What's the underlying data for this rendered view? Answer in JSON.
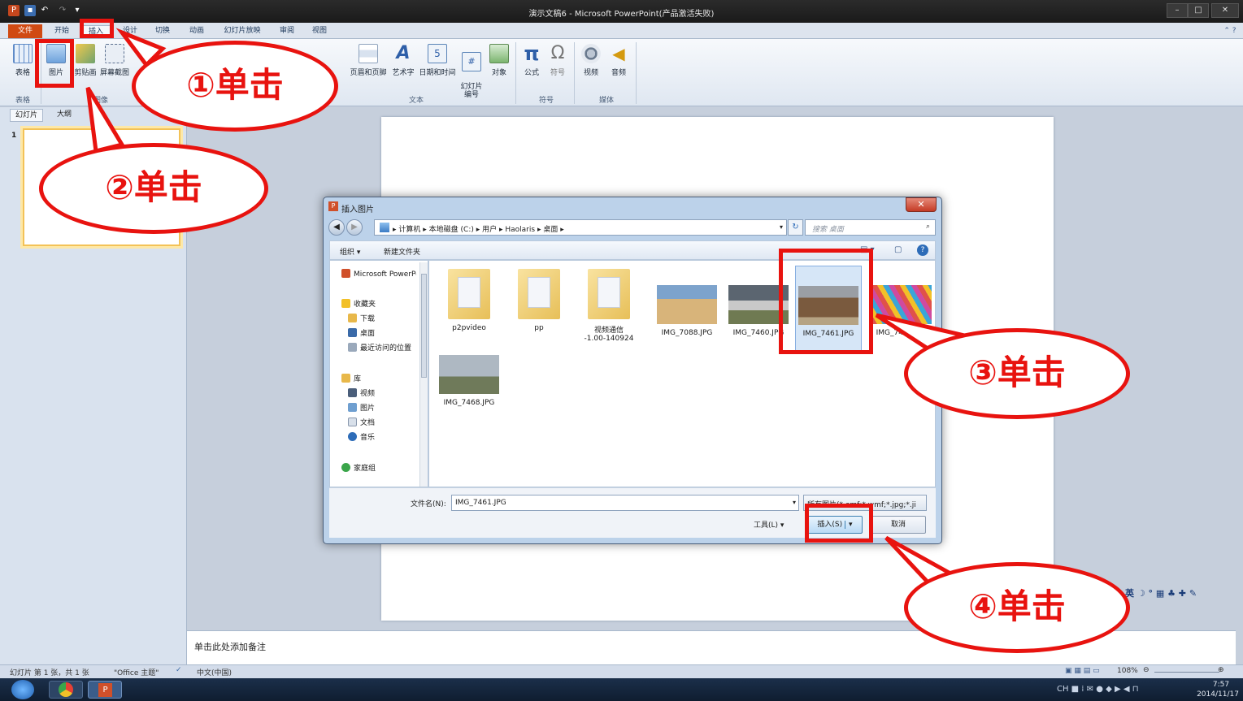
{
  "window": {
    "title": "演示文稿6 - Microsoft PowerPoint(产品激活失败)",
    "app_icon": "P"
  },
  "menu": {
    "tabs": [
      "文件",
      "开始",
      "插入",
      "设计",
      "切换",
      "动画",
      "幻灯片放映",
      "审阅",
      "视图"
    ]
  },
  "ribbon": {
    "buttons": {
      "table": "表格",
      "picture": "图片",
      "clipart": "剪贴画",
      "screenshot": "屏幕截图",
      "header_footer": "页眉和页脚",
      "wordart": "艺术字",
      "datetime": "日期和时间",
      "slide_number": "幻灯片\n编号",
      "object": "对象",
      "equation": "公式",
      "symbol": "符号",
      "video": "视频",
      "audio": "音频"
    },
    "groups": {
      "tables": "表格",
      "images": "图像",
      "text": "文本",
      "symbols": "符号",
      "media": "媒体"
    }
  },
  "left_panel": {
    "tabs": [
      "幻灯片",
      "大纲"
    ],
    "slide_number": "1"
  },
  "notes": {
    "placeholder": "单击此处添加备注"
  },
  "status_bar": {
    "slide_info": "幻灯片 第 1 张，共 1 张",
    "theme": "\"Office 主题\"",
    "language": "中文(中国)",
    "zoom": "108%"
  },
  "taskbar": {
    "time": "7:57",
    "date": "2014/11/17",
    "ime": "英"
  },
  "dialog": {
    "title": "插入图片",
    "breadcrumb": [
      "计算机",
      "本地磁盘 (C:)",
      "用户",
      "Haolaris",
      "桌面"
    ],
    "search_placeholder": "搜索 桌面",
    "toolbar": {
      "organize": "组织 ▾",
      "new_folder": "新建文件夹"
    },
    "nav": {
      "recent_app": "Microsoft PowerPoint",
      "favorites": "收藏夹",
      "favorites_items": [
        "下载",
        "桌面",
        "最近访问的位置"
      ],
      "library": "库",
      "library_items": [
        "视频",
        "图片",
        "文档",
        "音乐"
      ],
      "homegroup": "家庭组"
    },
    "files": [
      {
        "name": "p2pvideo",
        "kind": "folder"
      },
      {
        "name": "pp",
        "kind": "folder"
      },
      {
        "name": "视频通信\n-1.00-140924",
        "kind": "folder"
      },
      {
        "name": "IMG_7088.JPG",
        "kind": "photo"
      },
      {
        "name": "IMG_7460.JPG",
        "kind": "photo"
      },
      {
        "name": "IMG_7461.JPG",
        "kind": "photo"
      },
      {
        "name": "IMG_7462.JPG",
        "kind": "photo"
      },
      {
        "name": "IMG_7468.JPG",
        "kind": "photo"
      }
    ],
    "filename_label": "文件名(N):",
    "filename_value": "IMG_7461.JPG",
    "filetype": "所有图片(*.emf;*.wmf;*.jpg;*.ji",
    "tools": "工具(L)",
    "insert": "插入(S)",
    "cancel": "取消"
  },
  "annotations": [
    "①单击",
    "②单击",
    "③单击",
    "④单击"
  ],
  "colors": {
    "annotation": "#e8130f",
    "file_tab": "#d04a12"
  }
}
